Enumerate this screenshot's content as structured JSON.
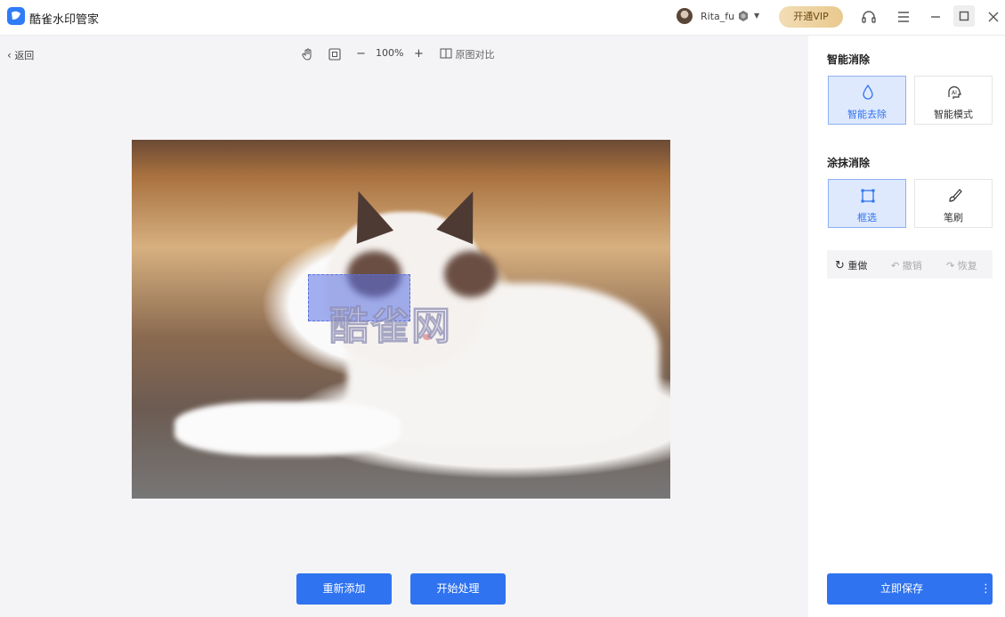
{
  "app": {
    "title": "酷雀水印管家"
  },
  "user": {
    "name": "Rita_fu",
    "vip_label": "开通VIP"
  },
  "toolbar": {
    "back_label": "返回",
    "zoom": "100%",
    "compare_label": "原图对比"
  },
  "canvas": {
    "watermark_text": "酷雀网"
  },
  "actions": {
    "re_add_label": "重新添加",
    "start_label": "开始处理"
  },
  "panel": {
    "smart_title": "智能消除",
    "smart_tools": [
      {
        "label": "智能去除"
      },
      {
        "label": "智能模式"
      }
    ],
    "smear_title": "涂抹消除",
    "smear_tools": [
      {
        "label": "框选"
      },
      {
        "label": "笔刷"
      }
    ],
    "history": {
      "reset": "重做",
      "undo": "撤销",
      "redo": "恢复"
    },
    "save_label": "立即保存"
  },
  "colors": {
    "accent": "#2f73f0",
    "vip_gold": "#e9c98d"
  }
}
